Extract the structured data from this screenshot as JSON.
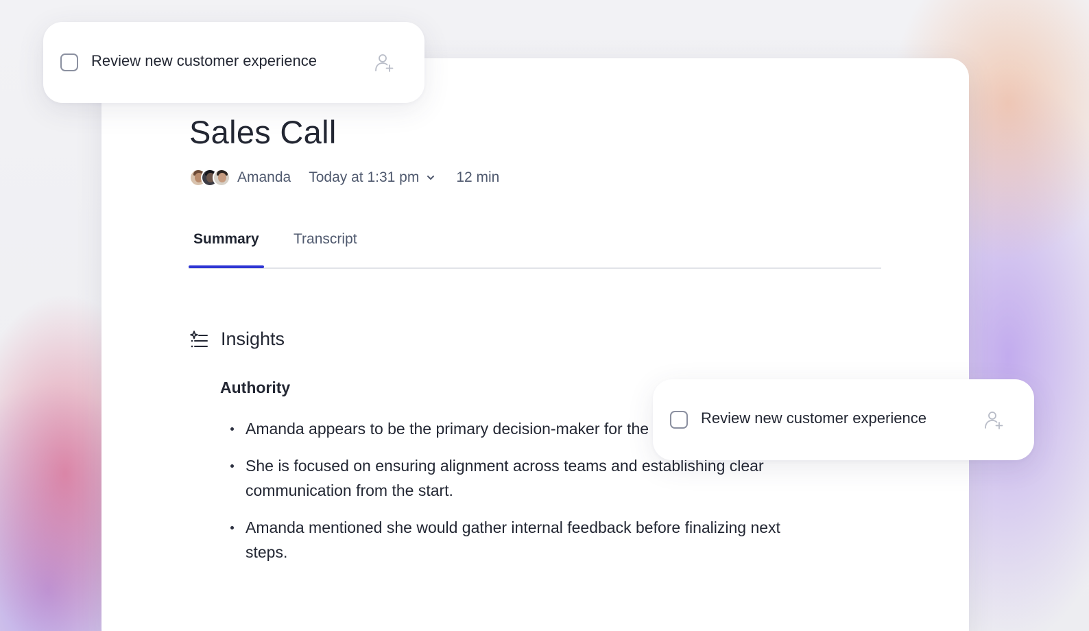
{
  "meeting": {
    "title": "Sales Call",
    "host": "Amanda",
    "datetime": "Today at 1:31 pm",
    "duration": "12 min",
    "participants": [
      {
        "avatar": "participant-avatar-1"
      },
      {
        "avatar": "participant-avatar-2"
      },
      {
        "avatar": "participant-avatar-3"
      }
    ]
  },
  "tabs": [
    {
      "label": "Summary",
      "active": true
    },
    {
      "label": "Transcript",
      "active": false
    }
  ],
  "insights": {
    "heading": "Insights",
    "icon": "sparkle-list-icon",
    "section": {
      "title": "Authority",
      "bullets": [
        "Amanda appears to be the primary decision-maker for the project’s direction.",
        "She is focused on ensuring alignment across teams and establishing clear communication from the start.",
        "Amanda mentioned she would gather internal feedback before finalizing next steps."
      ]
    }
  },
  "tasks": [
    {
      "label": "Review new customer experience",
      "checked": false,
      "assign_icon": "assign-person-icon"
    },
    {
      "label": "Review new customer experience",
      "checked": false,
      "assign_icon": "assign-person-icon"
    }
  ],
  "colors": {
    "accent": "#2e35d3",
    "text": "#232733",
    "muted": "#4f596e"
  }
}
